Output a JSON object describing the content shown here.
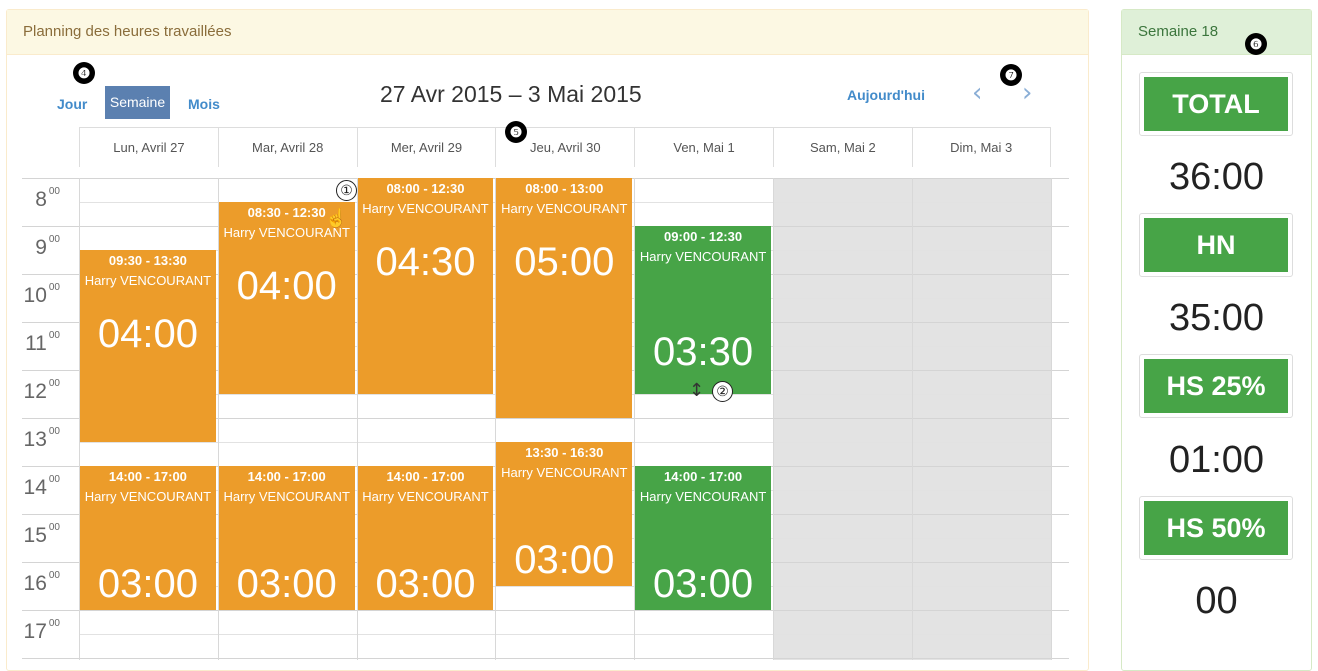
{
  "header": {
    "title": "Planning des heures travaillées"
  },
  "toolbar": {
    "view_day": "Jour",
    "view_week": "Semaine",
    "view_month": "Mois",
    "date_range": "27 Avr 2015 – 3 Mai 2015",
    "today": "Aujourd'hui",
    "prev": "‹",
    "next": "›"
  },
  "callouts": [
    "❹",
    "❺",
    "❻",
    "❼",
    "①",
    "②"
  ],
  "days": [
    "Lun, Avril 27",
    "Mar, Avril 28",
    "Mer, Avril 29",
    "Jeu, Avril 30",
    "Ven, Mai 1",
    "Sam, Mai 2",
    "Dim, Mai 3"
  ],
  "hours": [
    "8",
    "9",
    "10",
    "11",
    "12",
    "13",
    "14",
    "15",
    "16",
    "17"
  ],
  "hour_suffix": "00",
  "events": [
    {
      "day": 0,
      "start": 9.5,
      "end": 13.5,
      "time": "09:30 - 13:30",
      "name": "Harry VENCOURANT",
      "duration": "04:00",
      "color": "#ec9c2a"
    },
    {
      "day": 1,
      "start": 8.5,
      "end": 12.5,
      "time": "08:30 - 12:30",
      "name": "Harry VENCOURANT",
      "duration": "04:00",
      "color": "#ec9c2a"
    },
    {
      "day": 2,
      "start": 8,
      "end": 12.5,
      "time": "08:00 - 12:30",
      "name": "Harry VENCOURANT",
      "duration": "04:30",
      "color": "#ec9c2a"
    },
    {
      "day": 3,
      "start": 8,
      "end": 13,
      "time": "08:00 - 13:00",
      "name": "Harry VENCOURANT",
      "duration": "05:00",
      "color": "#ec9c2a"
    },
    {
      "day": 4,
      "start": 9,
      "end": 12.5,
      "time": "09:00 - 12:30",
      "name": "Harry VENCOURANT",
      "duration": "03:30",
      "color": "#47a447"
    },
    {
      "day": 0,
      "start": 14,
      "end": 17,
      "time": "14:00 - 17:00",
      "name": "Harry VENCOURANT",
      "duration": "03:00",
      "color": "#ec9c2a"
    },
    {
      "day": 1,
      "start": 14,
      "end": 17,
      "time": "14:00 - 17:00",
      "name": "Harry VENCOURANT",
      "duration": "03:00",
      "color": "#ec9c2a"
    },
    {
      "day": 2,
      "start": 14,
      "end": 17,
      "time": "14:00 - 17:00",
      "name": "Harry VENCOURANT",
      "duration": "03:00",
      "color": "#ec9c2a"
    },
    {
      "day": 3,
      "start": 13.5,
      "end": 16.5,
      "time": "13:30 - 16:30",
      "name": "Harry VENCOURANT",
      "duration": "03:00",
      "color": "#ec9c2a"
    },
    {
      "day": 4,
      "start": 14,
      "end": 17,
      "time": "14:00 - 17:00",
      "name": "Harry VENCOURANT",
      "duration": "03:00",
      "color": "#47a447"
    }
  ],
  "summary": {
    "title": "Semaine 18",
    "items": [
      {
        "label": "TOTAL",
        "value": "36:00"
      },
      {
        "label": "HN",
        "value": "35:00"
      },
      {
        "label": "HS 25%",
        "value": "01:00"
      },
      {
        "label": "HS 50%",
        "value": "00"
      }
    ]
  },
  "colors": {
    "orange": "#ec9c2a",
    "green": "#47a447",
    "weekend": "#e3e3e3",
    "link": "#428bca"
  }
}
